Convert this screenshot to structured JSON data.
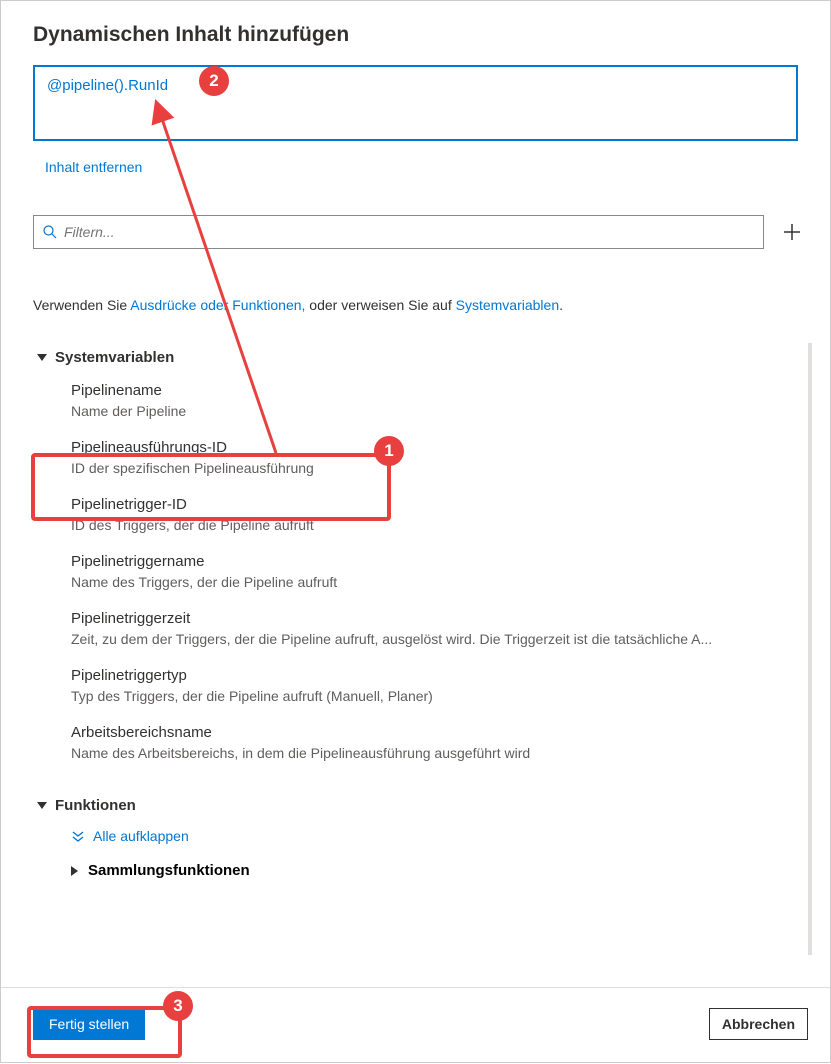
{
  "title": "Dynamischen Inhalt hinzufügen",
  "expression_value": "@pipeline().RunId",
  "remove_label": "Inhalt entfernen",
  "filter_placeholder": "Filtern...",
  "hint_prefix": "Verwenden Sie ",
  "hint_link1": "Ausdrücke oder Funktionen,",
  "hint_mid": " oder verweisen Sie auf ",
  "hint_link2": "Systemvariablen",
  "hint_suffix": ".",
  "section_sysvars": "Systemvariablen",
  "sysvars": [
    {
      "title": "Pipelinename",
      "desc": "Name der Pipeline"
    },
    {
      "title": "Pipelineausführungs-ID",
      "desc": "ID der spezifischen Pipelineausführung"
    },
    {
      "title": "Pipelinetrigger-ID",
      "desc": "ID des Triggers, der die Pipeline aufruft"
    },
    {
      "title": "Pipelinetriggername",
      "desc": "Name des Triggers, der die Pipeline aufruft"
    },
    {
      "title": "Pipelinetriggerzeit",
      "desc": "Zeit, zu dem der Triggers, der die Pipeline aufruft, ausgelöst wird. Die Triggerzeit ist die tatsächliche A..."
    },
    {
      "title": "Pipelinetriggertyp",
      "desc": "Typ des Triggers, der die Pipeline aufruft (Manuell, Planer)"
    },
    {
      "title": "Arbeitsbereichsname",
      "desc": "Name des Arbeitsbereichs, in dem die Pipelineausführung ausgeführt wird"
    }
  ],
  "section_functions": "Funktionen",
  "expand_all": "Alle aufklappen",
  "sub_collection": "Sammlungsfunktionen",
  "finish_label": "Fertig stellen",
  "cancel_label": "Abbrechen",
  "badges": {
    "b1": "1",
    "b2": "2",
    "b3": "3"
  }
}
